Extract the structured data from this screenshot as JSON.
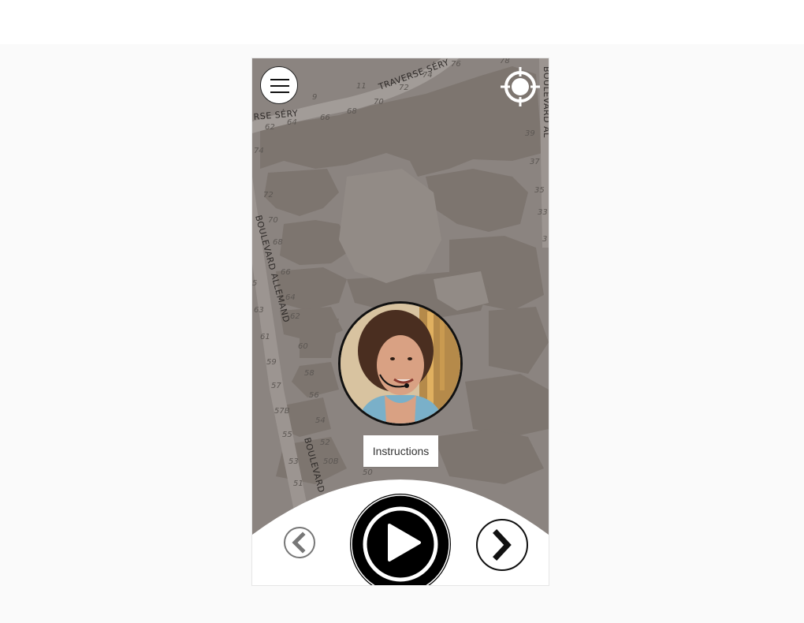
{
  "map": {
    "streets": [
      "TRAVERSE SÉRY",
      "RSE SÉRY",
      "BOULEVARD ALLEMAND",
      "BOULEVARD",
      "BOULEVARD AL"
    ],
    "house_numbers": [
      "11",
      "9",
      "66",
      "64",
      "62",
      "68",
      "70",
      "72",
      "74",
      "76",
      "78",
      "39",
      "37",
      "35",
      "33",
      "3",
      "72",
      "70",
      "68",
      "66",
      "64",
      "62",
      "60",
      "58",
      "56",
      "54",
      "52",
      "50",
      "50B",
      "74",
      "5",
      "63",
      "61",
      "59",
      "57",
      "57B",
      "55",
      "53",
      "51"
    ]
  },
  "controls": {
    "menu_icon": "hamburger-icon",
    "locate_icon": "crosshair-icon",
    "instructions_label": "Instructions",
    "prev_icon": "chevron-left-icon",
    "play_icon": "play-icon",
    "next_icon": "chevron-right-icon"
  },
  "colors": {
    "map_background": "#8b8480",
    "building": "#7d756f",
    "road": "#a29c98",
    "player_background": "#ffffff",
    "accent": "#000000"
  }
}
